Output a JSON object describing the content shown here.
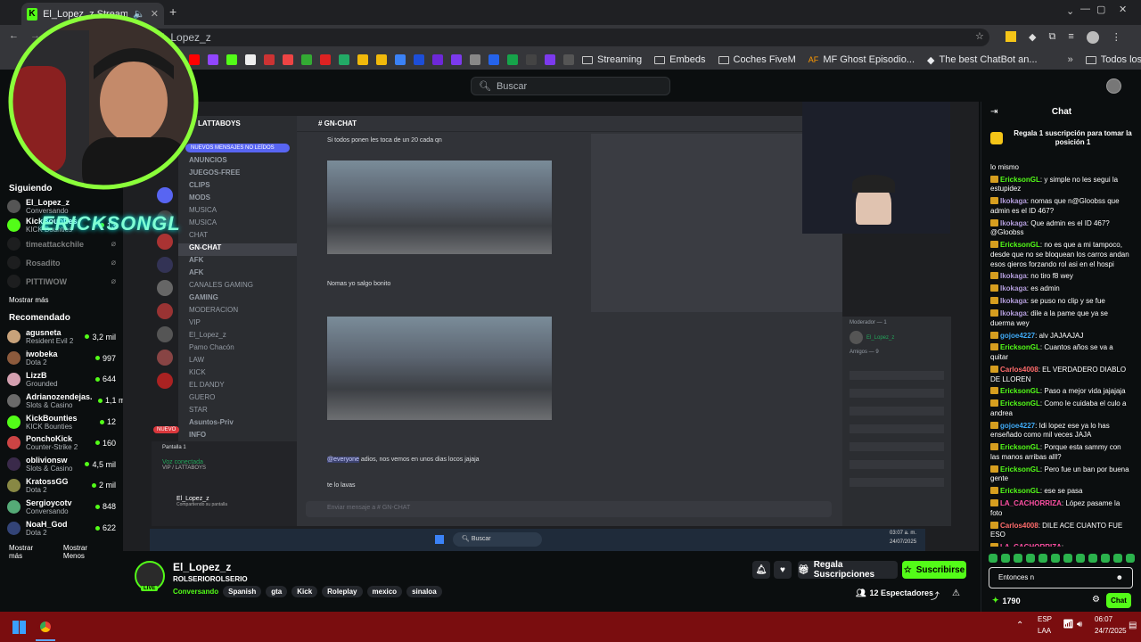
{
  "browser": {
    "tab_title": "El_Lopez_z Stream - watch",
    "url": "El_Lopez_z",
    "bookmarks": [
      "Streaming",
      "Embeds",
      "Coches FiveM",
      "MF Ghost Episodio...",
      "The best ChatBot an...",
      "Todos los marcadores"
    ]
  },
  "header": {
    "search_placeholder": "Buscar"
  },
  "sidebar": {
    "following_title": "Siguiendo",
    "following": [
      {
        "name": "El_Lopez_z",
        "sub": "Conversando",
        "count": ""
      },
      {
        "name": "KickBounties",
        "sub": "KICK Bounties",
        "count": "13"
      },
      {
        "name": "timeattackchile",
        "sub": "",
        "count": ""
      },
      {
        "name": "Rosadito",
        "sub": "",
        "count": ""
      },
      {
        "name": "PITTIWOW",
        "sub": "",
        "count": ""
      }
    ],
    "show_more": "Mostrar más",
    "recommended_title": "Recomendado",
    "recommended": [
      {
        "name": "agusneta",
        "sub": "Resident Evil 2",
        "count": "3,2 mil",
        "color": "#c8a27a"
      },
      {
        "name": "iwobeka",
        "sub": "Dota 2",
        "count": "997",
        "color": "#8c5a3c"
      },
      {
        "name": "LizzB",
        "sub": "Grounded",
        "count": "644",
        "color": "#d4a0b0"
      },
      {
        "name": "Adrianozendejas...",
        "sub": "Slots & Casino",
        "count": "1,1 mil",
        "color": "#6a6a6a"
      },
      {
        "name": "KickBounties",
        "sub": "KICK Bounties",
        "count": "12",
        "color": "#53fc18"
      },
      {
        "name": "PonchoKick",
        "sub": "Counter-Strike 2",
        "count": "160",
        "color": "#c44"
      },
      {
        "name": "oblivionsw",
        "sub": "Slots & Casino",
        "count": "4,5 mil",
        "color": "#3a2a4a"
      },
      {
        "name": "KratossGG",
        "sub": "Dota 2",
        "count": "2 mil",
        "color": "#884"
      },
      {
        "name": "Sergioycotv",
        "sub": "Conversando",
        "count": "848",
        "color": "#5a7"
      },
      {
        "name": "NoaH_God",
        "sub": "Dota 2",
        "count": "622",
        "color": "#347"
      }
    ],
    "show_more_2": "Mostrar más",
    "show_less": "Mostrar Menos"
  },
  "discord": {
    "server": "LATTABOYS",
    "new_msgs": "NUEVOS MENSAJES NO LEÍDOS",
    "channels": [
      "ANUNCIOS",
      "JUEGOS-FREE",
      "CLIPS",
      "MODS",
      "MUSICA",
      "MUSICA",
      "CHAT",
      "GN-CHAT",
      "AFK",
      "AFK",
      "CANALES GAMING",
      "GAMING",
      "MODERACION",
      "VIP",
      "El_Lopez_z",
      "Pamo Chacón",
      "LAW",
      "KICK",
      "EL DANDY",
      "GUERO",
      "STAR",
      "Asuntos-Priv",
      "INFO"
    ],
    "channel_title": "GN-CHAT",
    "top_msg": "Si todos ponen les toca de un 20 cada qn",
    "msg2": "Nomas yo salgo bonito",
    "msg3": "adios, nos vemos en unos dias locos jajaja",
    "msg3_mention": "@everyone",
    "msg4": "te lo lavas",
    "input_placeholder": "Enviar mensaje a # GN-CHAT",
    "voice_connected": "Voz conectada",
    "voice_channel": "VIP / LATTABOYS",
    "screen": "Pantalla 1",
    "user": "El_Lopez_z",
    "user_sub": "Compartiendo su pantalla",
    "live": "EN DIRECTO",
    "new_badge": "NUEVO",
    "taskbar_search": "Buscar",
    "time": "03:07 a. m.",
    "date": "24/07/2025"
  },
  "overlay_text": "ERICKSONGL",
  "channel": {
    "name": "El_Lopez_z",
    "subtitle": "ROLSERIOROLSERIO",
    "category": "Conversando",
    "tags": [
      "Spanish",
      "gta",
      "Kick",
      "Roleplay",
      "mexico",
      "sinaloa"
    ],
    "gift_button": "Regala Suscripciones",
    "subscribe_button": "Suscribirse",
    "viewers": "12 Espectadores",
    "live_badge": "LIVE"
  },
  "chat": {
    "title": "Chat",
    "pinned": "Regala 1 suscripción para tomar la posición 1",
    "messages": [
      {
        "user": "",
        "text": "lo mismo",
        "color": "#fff"
      },
      {
        "user": "EricksonGL",
        "text": "y simple no les segui la estupidez",
        "color": "#53fc18"
      },
      {
        "user": "Ikokaga",
        "text": "nomas que n@Gloobss que admin es el ID 467?",
        "color": "#b39ddb"
      },
      {
        "user": "Ikokaga",
        "text": "Que admin es el ID 467? @Gloobss",
        "color": "#b39ddb"
      },
      {
        "user": "EricksonGL",
        "text": "no es que a mi tampoco, desde que no se bloquean los carros andan esos qieros forzando rol asi en el hospi",
        "color": "#53fc18"
      },
      {
        "user": "Ikokaga",
        "text": "no tiro f8 wey",
        "color": "#b39ddb"
      },
      {
        "user": "Ikokaga",
        "text": "es admin",
        "color": "#b39ddb"
      },
      {
        "user": "Ikokaga",
        "text": "se puso no clip y se fue",
        "color": "#b39ddb"
      },
      {
        "user": "Ikokaga",
        "text": "dile a la pame que ya se duerma wey",
        "color": "#b39ddb"
      },
      {
        "user": "gojoe4227",
        "text": "alv JAJAAJAJ",
        "color": "#3fa9f5"
      },
      {
        "user": "EricksonGL",
        "text": "Cuantos años se va a quitar",
        "color": "#53fc18"
      },
      {
        "user": "Carlos4008",
        "text": "EL VERDADERO DIABLO DE LLOREN",
        "color": "#ff6b6b"
      },
      {
        "user": "EricksonGL",
        "text": "Paso a mejor vida jajajaja",
        "color": "#53fc18"
      },
      {
        "user": "EricksonGL",
        "text": "Como le cuidaba el culo a andrea",
        "color": "#53fc18"
      },
      {
        "user": "gojoe4227",
        "text": "Idi lopez ese ya lo has enseñado como mil veces JAJA",
        "color": "#3fa9f5"
      },
      {
        "user": "EricksonGL",
        "text": "Porque esta sammy con las manos arribas alll?",
        "color": "#53fc18"
      },
      {
        "user": "EricksonGL",
        "text": "Pero fue un ban por buena gente",
        "color": "#53fc18"
      },
      {
        "user": "EricksonGL",
        "text": "ese se pasa",
        "color": "#53fc18"
      },
      {
        "user": "LA_CACHORRIZA",
        "text": "López pasame la foto",
        "color": "#ff4fa3"
      },
      {
        "user": "Carlos4008",
        "text": "DILE ACE CUANTO FUE ESO",
        "color": "#ff6b6b"
      },
      {
        "user": "LA_CACHORRIZA",
        "text": "",
        "color": "#ff4fa3"
      }
    ],
    "input_value": "Entonces n",
    "points": "1790",
    "send": "Chat"
  },
  "taskbar": {
    "lang1": "ESP",
    "lang2": "LAA",
    "time": "06:07",
    "date": "24/7/2025"
  }
}
